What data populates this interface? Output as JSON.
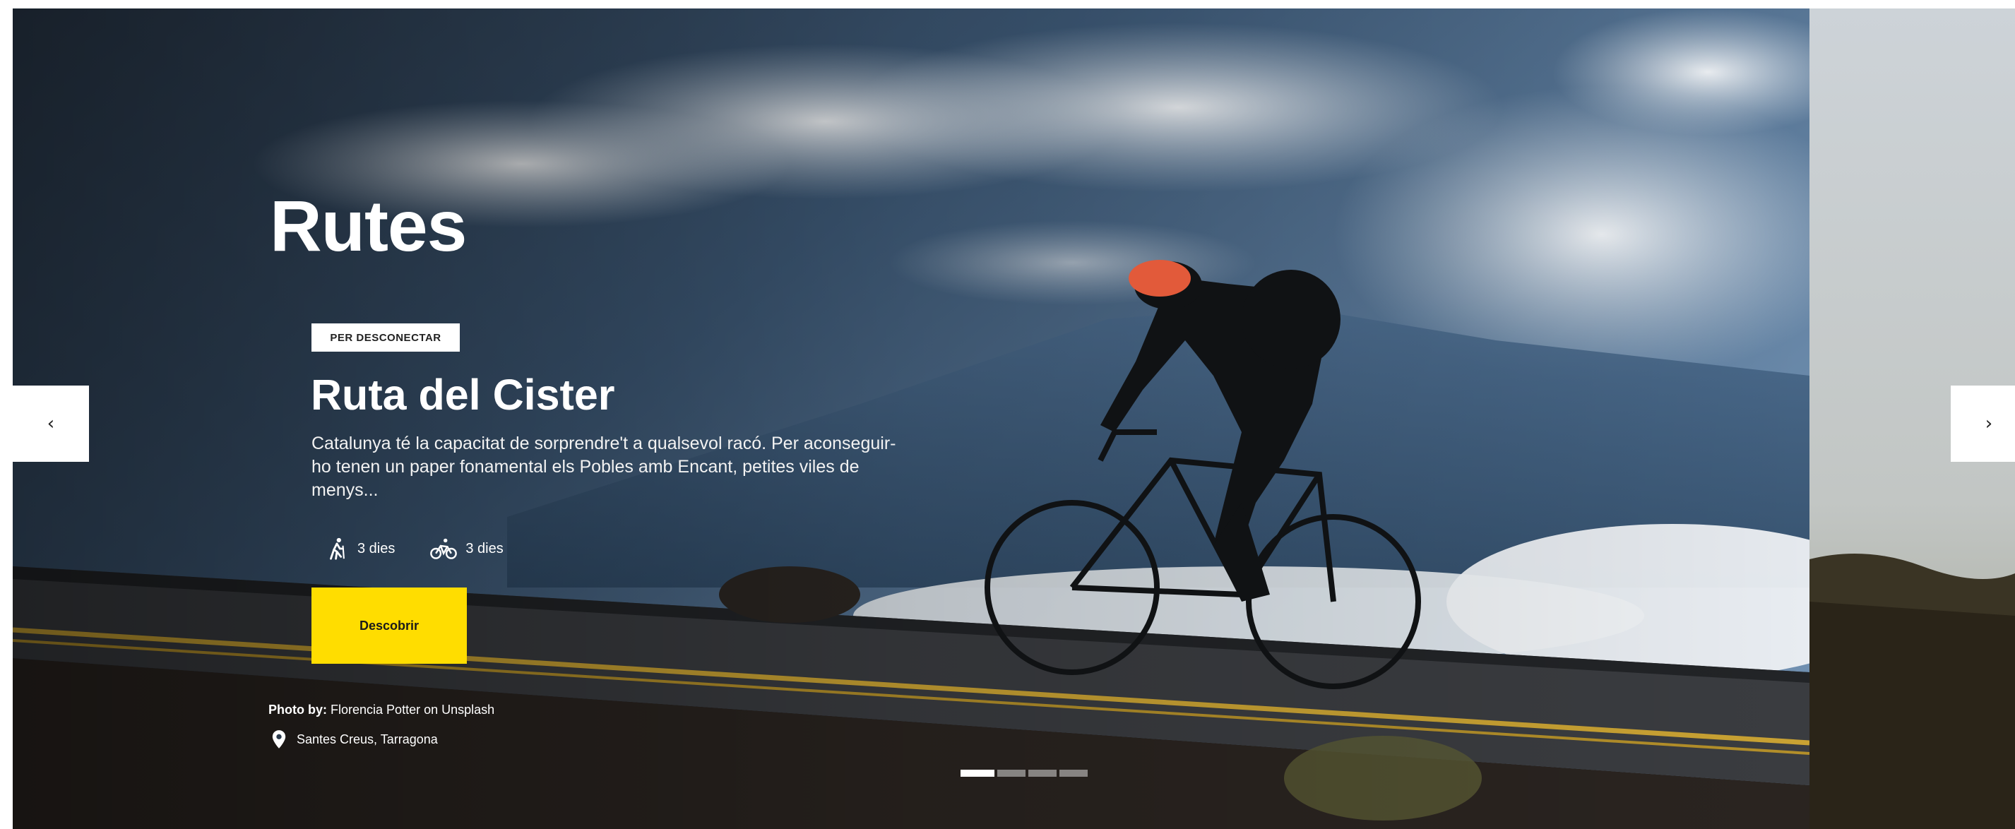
{
  "hero": {
    "section_title": "Rutes",
    "tag": "PER DESCONECTAR",
    "route_title": "Ruta del Cister",
    "description": "Catalunya té la capacitat de sorprendre't a qualsevol racó. Per aconseguir-ho tenen un paper fonamental els Pobles amb Encant, petites viles de menys...",
    "stats": [
      {
        "icon": "hiking-icon",
        "label": "3 dies"
      },
      {
        "icon": "bicycle-icon",
        "label": "3 dies"
      }
    ],
    "cta_label": "Descobrir",
    "photo_credit_prefix": "Photo by:",
    "photo_credit_name": "Florencia Potter on Unsplash",
    "location": "Santes Creus, Tarragona"
  },
  "carousel": {
    "prev_label": "‹",
    "next_label": "›",
    "slide_count": 4,
    "active_index": 0
  },
  "colors": {
    "accent": "#ffdd00",
    "text": "#ffffff"
  }
}
